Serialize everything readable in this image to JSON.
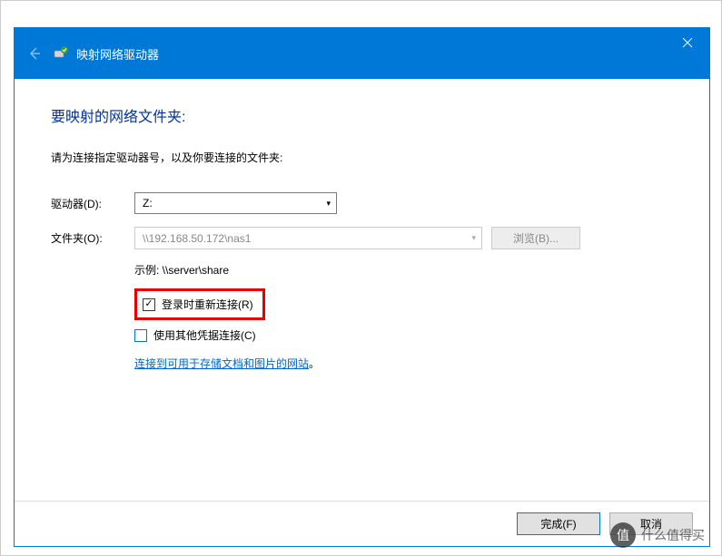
{
  "titlebar": {
    "title": "映射网络驱动器"
  },
  "content": {
    "heading": "要映射的网络文件夹:",
    "instruction": "请为连接指定驱动器号，以及你要连接的文件夹:",
    "drive_label": "驱动器(D):",
    "drive_value": "Z:",
    "folder_label": "文件夹(O):",
    "folder_value": "\\\\192.168.50.172\\nas1",
    "browse_label": "浏览(B)...",
    "example_text": "示例: \\\\server\\share",
    "reconnect_label": "登录时重新连接(R)",
    "other_creds_label": "使用其他凭据连接(C)",
    "link_text": "连接到可用于存储文档和图片的网站",
    "link_period": "。"
  },
  "buttons": {
    "finish": "完成(F)",
    "cancel": "取消"
  },
  "watermark": {
    "text": "什么值得买"
  }
}
